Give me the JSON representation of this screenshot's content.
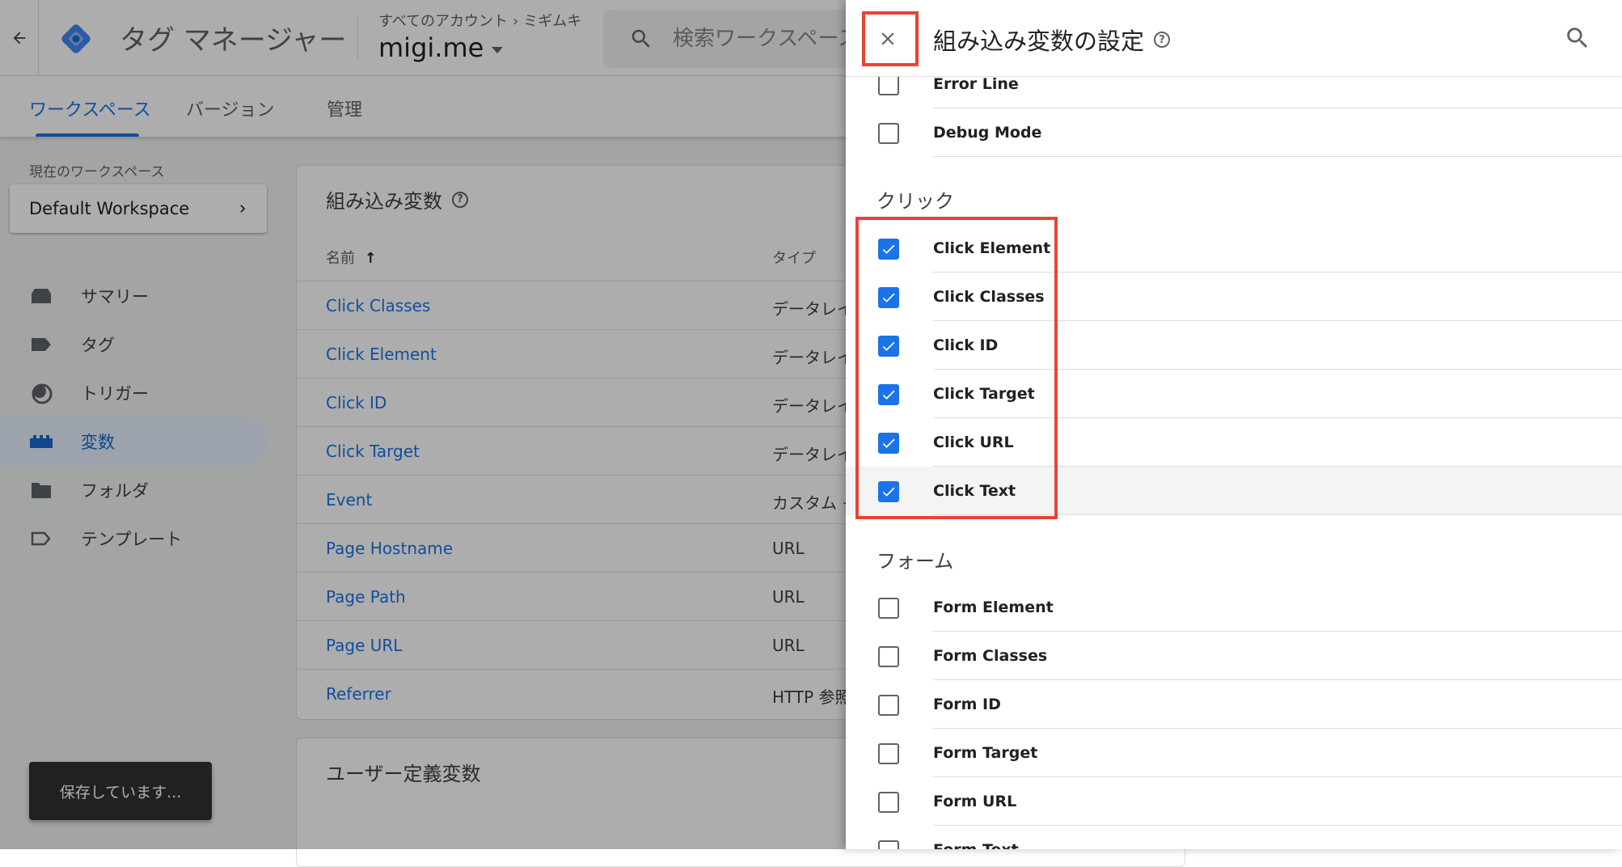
{
  "app": {
    "title": "タグ マネージャー",
    "breadcrumb": [
      "すべてのアカウント",
      "ミギムキ"
    ],
    "breadcrumb_sep": "›",
    "container": "migi.me",
    "search_placeholder": "検索ワークスペース"
  },
  "tabs": [
    {
      "label": "ワークスペース",
      "active": true
    },
    {
      "label": "バージョン",
      "active": false
    },
    {
      "label": "管理",
      "active": false
    }
  ],
  "workspace": {
    "label": "現在のワークスペース",
    "name": "Default Workspace"
  },
  "nav": [
    {
      "label": "サマリー",
      "icon": "summary-icon",
      "active": false
    },
    {
      "label": "タグ",
      "icon": "tag-icon",
      "active": false
    },
    {
      "label": "トリガー",
      "icon": "trigger-icon",
      "active": false
    },
    {
      "label": "変数",
      "icon": "variables-icon",
      "active": true
    },
    {
      "label": "フォルダ",
      "icon": "folder-icon",
      "active": false
    },
    {
      "label": "テンプレート",
      "icon": "template-icon",
      "active": false
    }
  ],
  "builtin_card": {
    "title": "組み込み変数",
    "col_name": "名前",
    "col_type": "タイプ",
    "rows": [
      {
        "name": "Click Classes",
        "type": "データレイ"
      },
      {
        "name": "Click Element",
        "type": "データレイ"
      },
      {
        "name": "Click ID",
        "type": "データレイ"
      },
      {
        "name": "Click Target",
        "type": "データレイ"
      },
      {
        "name": "Event",
        "type": "カスタム イ"
      },
      {
        "name": "Page Hostname",
        "type": "URL"
      },
      {
        "name": "Page Path",
        "type": "URL"
      },
      {
        "name": "Page URL",
        "type": "URL"
      },
      {
        "name": "Referrer",
        "type": "HTTP 参照"
      }
    ]
  },
  "user_card": {
    "title": "ユーザー定義変数"
  },
  "toast": "保存しています...",
  "panel": {
    "title": "組み込み変数の設定",
    "top_items": [
      {
        "label": "Error Line",
        "checked": false
      },
      {
        "label": "Debug Mode",
        "checked": false
      }
    ],
    "click_section": "クリック",
    "click_items": [
      {
        "label": "Click Element",
        "checked": true
      },
      {
        "label": "Click Classes",
        "checked": true
      },
      {
        "label": "Click ID",
        "checked": true
      },
      {
        "label": "Click Target",
        "checked": true
      },
      {
        "label": "Click URL",
        "checked": true
      },
      {
        "label": "Click Text",
        "checked": true
      }
    ],
    "form_section": "フォーム",
    "form_items": [
      {
        "label": "Form Element",
        "checked": false
      },
      {
        "label": "Form Classes",
        "checked": false
      },
      {
        "label": "Form ID",
        "checked": false
      },
      {
        "label": "Form Target",
        "checked": false
      },
      {
        "label": "Form URL",
        "checked": false
      },
      {
        "label": "Form Text",
        "checked": false
      }
    ]
  },
  "colors": {
    "accent": "#1a73e8",
    "highlight": "#ea4335",
    "toast_bg": "#323232"
  }
}
